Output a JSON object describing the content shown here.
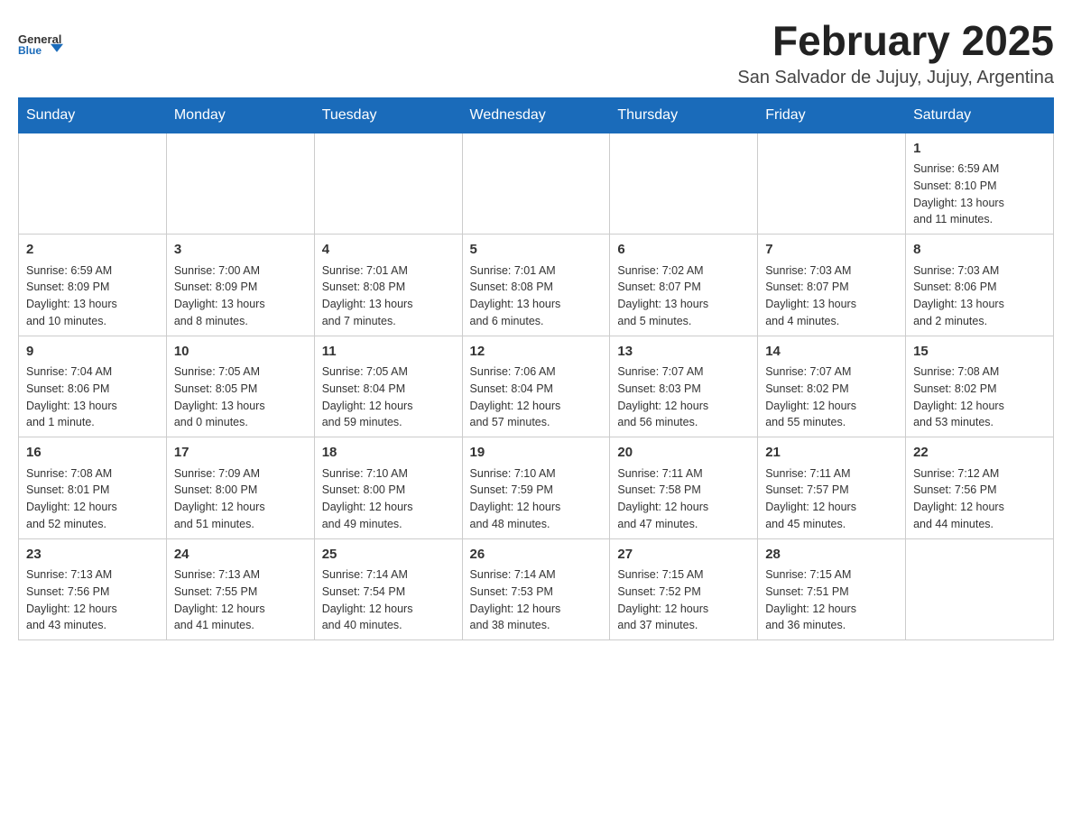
{
  "header": {
    "logo_text_general": "General",
    "logo_text_blue": "Blue",
    "month_title": "February 2025",
    "location": "San Salvador de Jujuy, Jujuy, Argentina"
  },
  "days_of_week": [
    "Sunday",
    "Monday",
    "Tuesday",
    "Wednesday",
    "Thursday",
    "Friday",
    "Saturday"
  ],
  "weeks": [
    [
      {
        "day": "",
        "info": ""
      },
      {
        "day": "",
        "info": ""
      },
      {
        "day": "",
        "info": ""
      },
      {
        "day": "",
        "info": ""
      },
      {
        "day": "",
        "info": ""
      },
      {
        "day": "",
        "info": ""
      },
      {
        "day": "1",
        "info": "Sunrise: 6:59 AM\nSunset: 8:10 PM\nDaylight: 13 hours\nand 11 minutes."
      }
    ],
    [
      {
        "day": "2",
        "info": "Sunrise: 6:59 AM\nSunset: 8:09 PM\nDaylight: 13 hours\nand 10 minutes."
      },
      {
        "day": "3",
        "info": "Sunrise: 7:00 AM\nSunset: 8:09 PM\nDaylight: 13 hours\nand 8 minutes."
      },
      {
        "day": "4",
        "info": "Sunrise: 7:01 AM\nSunset: 8:08 PM\nDaylight: 13 hours\nand 7 minutes."
      },
      {
        "day": "5",
        "info": "Sunrise: 7:01 AM\nSunset: 8:08 PM\nDaylight: 13 hours\nand 6 minutes."
      },
      {
        "day": "6",
        "info": "Sunrise: 7:02 AM\nSunset: 8:07 PM\nDaylight: 13 hours\nand 5 minutes."
      },
      {
        "day": "7",
        "info": "Sunrise: 7:03 AM\nSunset: 8:07 PM\nDaylight: 13 hours\nand 4 minutes."
      },
      {
        "day": "8",
        "info": "Sunrise: 7:03 AM\nSunset: 8:06 PM\nDaylight: 13 hours\nand 2 minutes."
      }
    ],
    [
      {
        "day": "9",
        "info": "Sunrise: 7:04 AM\nSunset: 8:06 PM\nDaylight: 13 hours\nand 1 minute."
      },
      {
        "day": "10",
        "info": "Sunrise: 7:05 AM\nSunset: 8:05 PM\nDaylight: 13 hours\nand 0 minutes."
      },
      {
        "day": "11",
        "info": "Sunrise: 7:05 AM\nSunset: 8:04 PM\nDaylight: 12 hours\nand 59 minutes."
      },
      {
        "day": "12",
        "info": "Sunrise: 7:06 AM\nSunset: 8:04 PM\nDaylight: 12 hours\nand 57 minutes."
      },
      {
        "day": "13",
        "info": "Sunrise: 7:07 AM\nSunset: 8:03 PM\nDaylight: 12 hours\nand 56 minutes."
      },
      {
        "day": "14",
        "info": "Sunrise: 7:07 AM\nSunset: 8:02 PM\nDaylight: 12 hours\nand 55 minutes."
      },
      {
        "day": "15",
        "info": "Sunrise: 7:08 AM\nSunset: 8:02 PM\nDaylight: 12 hours\nand 53 minutes."
      }
    ],
    [
      {
        "day": "16",
        "info": "Sunrise: 7:08 AM\nSunset: 8:01 PM\nDaylight: 12 hours\nand 52 minutes."
      },
      {
        "day": "17",
        "info": "Sunrise: 7:09 AM\nSunset: 8:00 PM\nDaylight: 12 hours\nand 51 minutes."
      },
      {
        "day": "18",
        "info": "Sunrise: 7:10 AM\nSunset: 8:00 PM\nDaylight: 12 hours\nand 49 minutes."
      },
      {
        "day": "19",
        "info": "Sunrise: 7:10 AM\nSunset: 7:59 PM\nDaylight: 12 hours\nand 48 minutes."
      },
      {
        "day": "20",
        "info": "Sunrise: 7:11 AM\nSunset: 7:58 PM\nDaylight: 12 hours\nand 47 minutes."
      },
      {
        "day": "21",
        "info": "Sunrise: 7:11 AM\nSunset: 7:57 PM\nDaylight: 12 hours\nand 45 minutes."
      },
      {
        "day": "22",
        "info": "Sunrise: 7:12 AM\nSunset: 7:56 PM\nDaylight: 12 hours\nand 44 minutes."
      }
    ],
    [
      {
        "day": "23",
        "info": "Sunrise: 7:13 AM\nSunset: 7:56 PM\nDaylight: 12 hours\nand 43 minutes."
      },
      {
        "day": "24",
        "info": "Sunrise: 7:13 AM\nSunset: 7:55 PM\nDaylight: 12 hours\nand 41 minutes."
      },
      {
        "day": "25",
        "info": "Sunrise: 7:14 AM\nSunset: 7:54 PM\nDaylight: 12 hours\nand 40 minutes."
      },
      {
        "day": "26",
        "info": "Sunrise: 7:14 AM\nSunset: 7:53 PM\nDaylight: 12 hours\nand 38 minutes."
      },
      {
        "day": "27",
        "info": "Sunrise: 7:15 AM\nSunset: 7:52 PM\nDaylight: 12 hours\nand 37 minutes."
      },
      {
        "day": "28",
        "info": "Sunrise: 7:15 AM\nSunset: 7:51 PM\nDaylight: 12 hours\nand 36 minutes."
      },
      {
        "day": "",
        "info": ""
      }
    ]
  ]
}
